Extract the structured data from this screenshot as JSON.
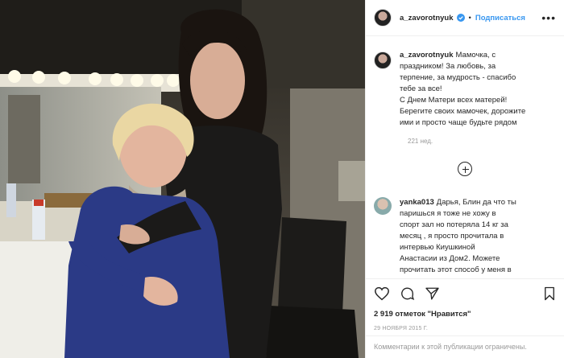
{
  "post": {
    "username": "a_zavorotnyuk",
    "follow_label": "Подписаться",
    "separator": "•",
    "more_label": "•••"
  },
  "caption": {
    "username": "a_zavorotnyuk",
    "lines": [
      "Мамочка, с",
      "праздником! За любовь, за",
      "терпение, за мудрость - спасибо",
      "тебе за все!",
      "С Днем Матери всех матерей!",
      "Берегите своих мамочек, дорожите",
      "ими и просто чаще будьте рядом"
    ],
    "time": "221 нед."
  },
  "comment": {
    "username": "yanka013",
    "lines": [
      "Дарья, Блин да что ты",
      "паришься я тоже не хожу в",
      "спорт зал но потеряла 14 кг за",
      "месяц , я просто прочитала в",
      "интервью Киушкиной",
      "Анастасии из Дом2. Можете",
      "прочитать этот способ у меня в"
    ]
  },
  "likes": "2 919 отметок \"Нравится\"",
  "date": "29 НОЯБРЯ 2015 Г.",
  "footer": "Комментарии к этой публикации ограничены.",
  "icons": [
    "heart-icon",
    "comment-icon",
    "share-icon",
    "bookmark-icon",
    "add-comment-icon",
    "verified-icon",
    "more-options-icon"
  ],
  "colors": {
    "link_blue": "#3897f0",
    "verified_blue": "#3897f0",
    "muted_gray": "#999999",
    "text": "#262626",
    "border": "#efefef"
  }
}
